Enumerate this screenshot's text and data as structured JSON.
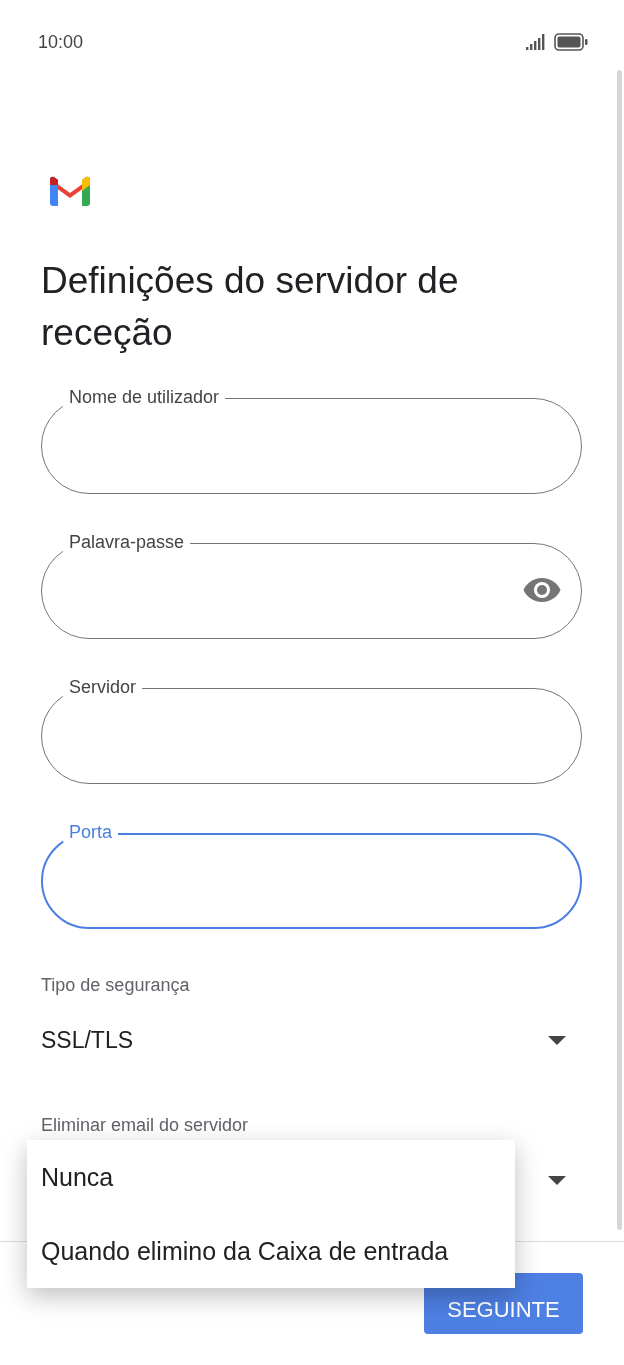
{
  "status_bar": {
    "time": "10:00"
  },
  "title": "Definições do servidor de receção",
  "fields": [
    {
      "label": "Nome de utilizador",
      "kind": "text",
      "focused": false
    },
    {
      "label": "Palavra-passe",
      "kind": "password",
      "focused": false
    },
    {
      "label": "Servidor",
      "kind": "text",
      "focused": false
    },
    {
      "label": "Porta",
      "kind": "text",
      "focused": true
    }
  ],
  "dropdowns": [
    {
      "label": "Tipo de segurança",
      "value": "SSL/TLS"
    },
    {
      "label": "Eliminar email do servidor"
    }
  ],
  "menu": {
    "options": [
      {
        "label": "Nunca"
      },
      {
        "label": "Quando elimino da Caixa de entrada"
      }
    ]
  },
  "next_button": {
    "label": "SEGUINTE"
  }
}
